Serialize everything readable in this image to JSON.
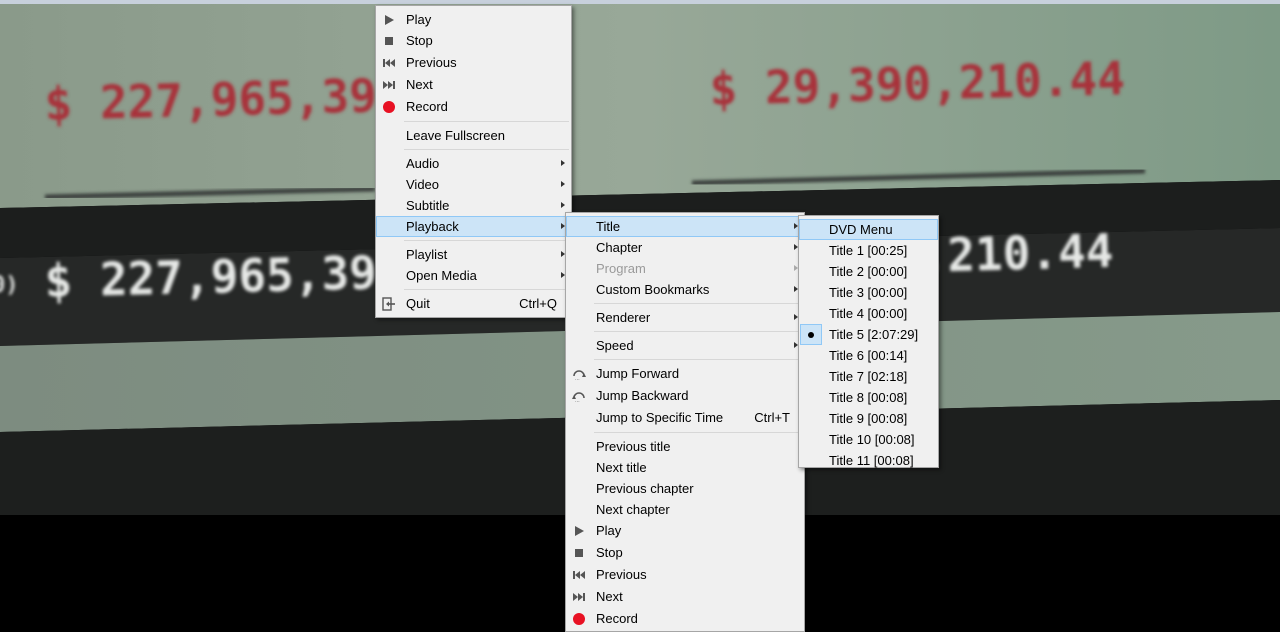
{
  "background": {
    "amount_top_left": "$ 227,965,39",
    "amount_top_right": "$ 29,390,210.44",
    "amount_bottom_left": "$ 227,965,39",
    "amount_bottom_right": ",210.44",
    "edge_fragment": "0)"
  },
  "main_menu": {
    "items": {
      "play": "Play",
      "stop": "Stop",
      "previous": "Previous",
      "next": "Next",
      "record": "Record",
      "leave_fullscreen": "Leave Fullscreen",
      "audio": "Audio",
      "video": "Video",
      "subtitle": "Subtitle",
      "playback": "Playback",
      "playlist": "Playlist",
      "open_media": "Open Media",
      "quit": "Quit",
      "quit_shortcut": "Ctrl+Q"
    }
  },
  "playback_menu": {
    "items": {
      "title": "Title",
      "chapter": "Chapter",
      "program": "Program",
      "custom_bookmarks": "Custom Bookmarks",
      "renderer": "Renderer",
      "speed": "Speed",
      "jump_forward": "Jump Forward",
      "jump_backward": "Jump Backward",
      "jump_specific": "Jump to Specific Time",
      "jump_specific_shortcut": "Ctrl+T",
      "previous_title": "Previous title",
      "next_title": "Next title",
      "previous_chapter": "Previous chapter",
      "next_chapter": "Next chapter",
      "play": "Play",
      "stop": "Stop",
      "previous": "Previous",
      "next": "Next",
      "record": "Record"
    }
  },
  "title_menu": {
    "items": [
      "DVD Menu",
      "Title 1 [00:25]",
      "Title 2 [00:00]",
      "Title 3 [00:00]",
      "Title 4 [00:00]",
      "Title 5 [2:07:29]",
      "Title 6 [00:14]",
      "Title 7 [02:18]",
      "Title 8 [00:08]",
      "Title 9 [00:08]",
      "Title 10 [00:08]",
      "Title 11 [00:08]"
    ],
    "selected_index": 5
  },
  "colors": {
    "record_red": "#e81123",
    "highlight": "#cce4f7",
    "amount_red": "#a8323a"
  }
}
